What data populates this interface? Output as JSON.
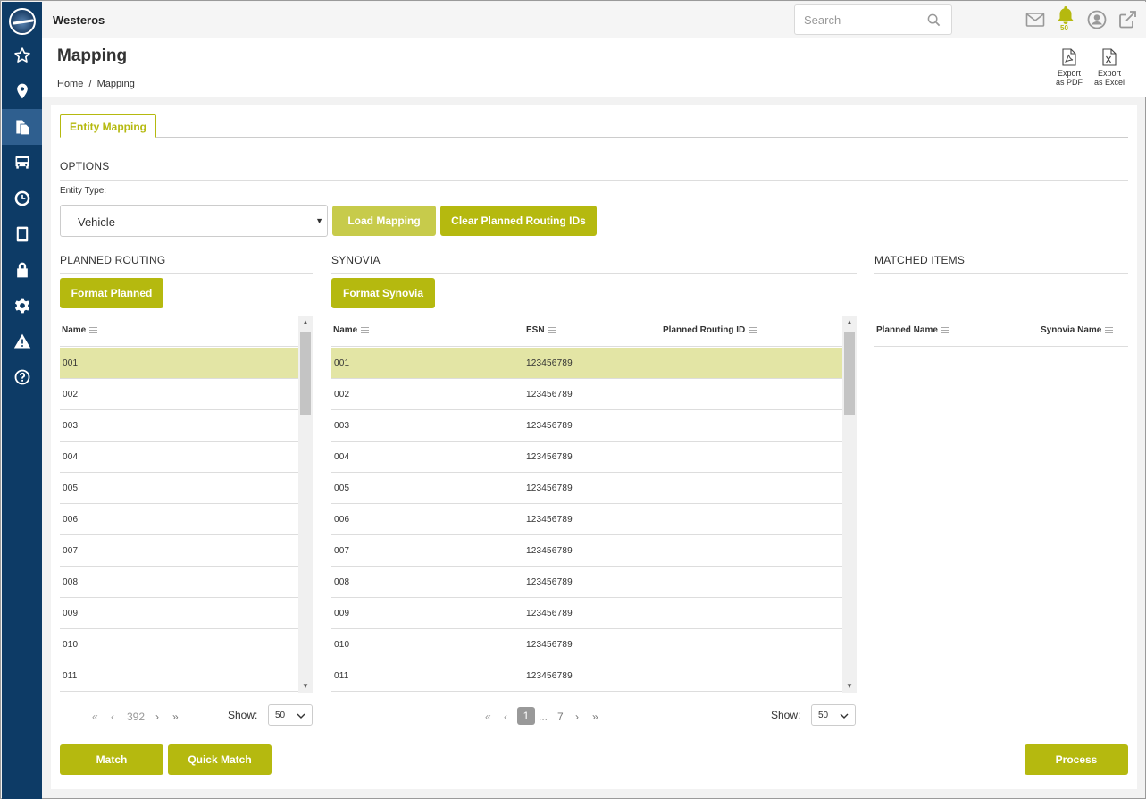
{
  "app": {
    "title": "Westeros"
  },
  "search": {
    "placeholder": "Search"
  },
  "notifications": {
    "count": "50"
  },
  "page": {
    "title": "Mapping",
    "breadcrumb": "Home  /  Mapping"
  },
  "exports": {
    "pdf": {
      "line1": "Export",
      "line2": "as PDF"
    },
    "excel": {
      "line1": "Export",
      "line2": "as Excel"
    }
  },
  "tabs": [
    {
      "label": "Entity Mapping",
      "active": true
    }
  ],
  "options": {
    "section_label": "OPTIONS",
    "entity_type_label": "Entity Type:",
    "entity_type_value": "Vehicle",
    "load_mapping_label": "Load Mapping",
    "clear_label": "Clear Planned Routing IDs"
  },
  "planned": {
    "section_label": "PLANNED ROUTING",
    "format_label": "Format Planned",
    "columns": [
      "Name"
    ],
    "rows": [
      "001",
      "002",
      "003",
      "004",
      "005",
      "006",
      "007",
      "008",
      "009",
      "010",
      "011"
    ],
    "selected_index": 0,
    "pager": {
      "pages": "392",
      "show_label": "Show:",
      "page_size": "50"
    }
  },
  "synovia": {
    "section_label": "SYNOVIA",
    "format_label": "Format Synovia",
    "columns": [
      "Name",
      "ESN",
      "Planned Routing ID"
    ],
    "rows": [
      {
        "name": "001",
        "esn": "123456789",
        "prid": ""
      },
      {
        "name": "002",
        "esn": "123456789",
        "prid": ""
      },
      {
        "name": "003",
        "esn": "123456789",
        "prid": ""
      },
      {
        "name": "004",
        "esn": "123456789",
        "prid": ""
      },
      {
        "name": "005",
        "esn": "123456789",
        "prid": ""
      },
      {
        "name": "006",
        "esn": "123456789",
        "prid": ""
      },
      {
        "name": "007",
        "esn": "123456789",
        "prid": ""
      },
      {
        "name": "008",
        "esn": "123456789",
        "prid": ""
      },
      {
        "name": "009",
        "esn": "123456789",
        "prid": ""
      },
      {
        "name": "010",
        "esn": "123456789",
        "prid": ""
      },
      {
        "name": "011",
        "esn": "123456789",
        "prid": ""
      }
    ],
    "selected_index": 0,
    "pager": {
      "current": "1",
      "ellipsis": "...",
      "last": "7",
      "show_label": "Show:",
      "page_size": "50"
    }
  },
  "matched": {
    "section_label": "MATCHED ITEMS",
    "columns": [
      "Planned Name",
      "Synovia Name"
    ]
  },
  "actions": {
    "match": "Match",
    "quick_match": "Quick Match",
    "process": "Process"
  },
  "colors": {
    "accent": "#b5b90f",
    "sidebar": "#0d3b66",
    "selected_row": "#e3e5a5"
  },
  "sidebar_icons": [
    "logo-icon",
    "star-icon",
    "location-pin-icon",
    "documents-icon",
    "bus-icon",
    "clock-icon",
    "tablet-icon",
    "lock-icon",
    "gear-icon",
    "warning-icon",
    "help-icon"
  ]
}
